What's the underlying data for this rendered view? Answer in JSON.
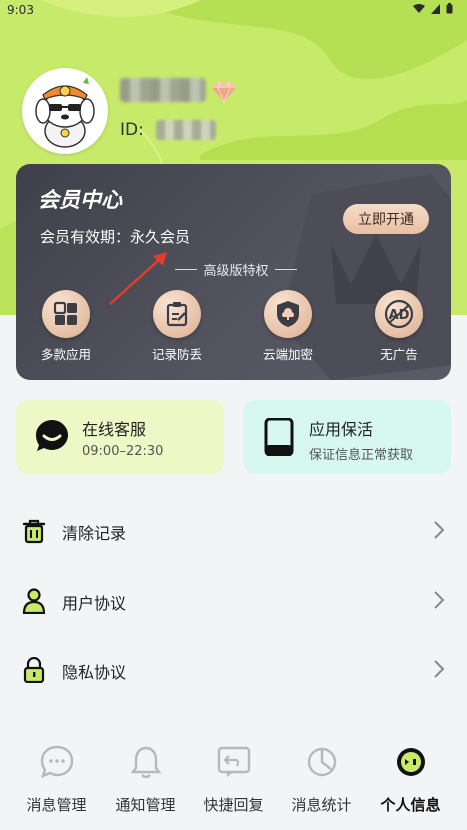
{
  "status_bar": {
    "time": "9:03"
  },
  "profile": {
    "id_label": "ID:"
  },
  "member_center": {
    "title": "会员中心",
    "validity": "会员有效期：永久会员",
    "open_button": "立即开通",
    "subtitle": "高级版特权",
    "features": [
      {
        "label": "多款应用",
        "icon": "grid-icon"
      },
      {
        "label": "记录防丢",
        "icon": "clipboard-icon"
      },
      {
        "label": "云端加密",
        "icon": "cloud-shield-icon"
      },
      {
        "label": "无广告",
        "icon": "ad-icon"
      }
    ]
  },
  "service_cards": {
    "support": {
      "title": "在线客服",
      "subtitle": "09:00–22:30",
      "icon": "chat-icon"
    },
    "keepalive": {
      "title": "应用保活",
      "subtitle": "保证信息正常获取",
      "icon": "phone-icon"
    }
  },
  "menu": [
    {
      "label": "清除记录",
      "icon": "trash-icon"
    },
    {
      "label": "用户协议",
      "icon": "user-icon"
    },
    {
      "label": "隐私协议",
      "icon": "lock-icon"
    }
  ],
  "tabbar": [
    {
      "label": "消息管理",
      "icon": "message-icon"
    },
    {
      "label": "通知管理",
      "icon": "bell-icon"
    },
    {
      "label": "快捷回复",
      "icon": "reply-icon"
    },
    {
      "label": "消息统计",
      "icon": "pie-chart-icon"
    },
    {
      "label": "个人信息",
      "icon": "profile-face-icon",
      "active": true
    }
  ],
  "colors": {
    "accent_green": "#c8ea6a",
    "card_dark": "#44454f",
    "gold": "#e8bfa2"
  }
}
